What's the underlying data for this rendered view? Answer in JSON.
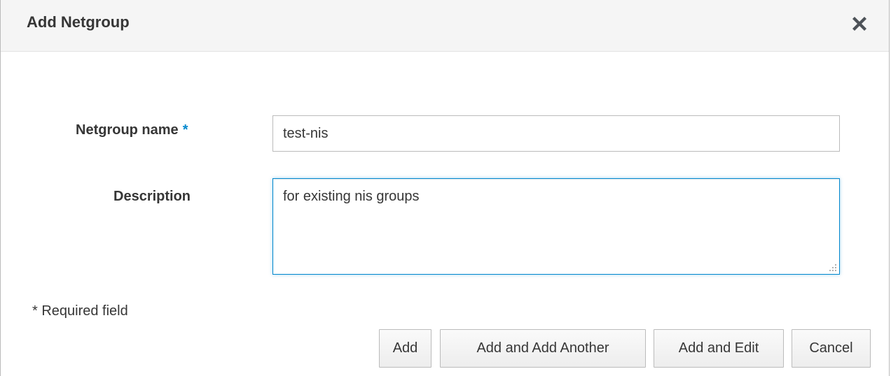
{
  "dialog": {
    "title": "Add Netgroup",
    "close_icon": "close-icon"
  },
  "form": {
    "netgroup_name": {
      "label": "Netgroup name",
      "required_mark": "*",
      "value": "test-nis"
    },
    "description": {
      "label": "Description",
      "value": "for existing nis groups"
    },
    "required_note": "* Required field"
  },
  "buttons": {
    "add": "Add",
    "add_and_add_another": "Add and Add Another",
    "add_and_edit": "Add and Edit",
    "cancel": "Cancel"
  },
  "colors": {
    "accent": "#0088ce",
    "header_bg": "#f5f5f5",
    "text": "#363636",
    "border": "#bbbbbb"
  }
}
